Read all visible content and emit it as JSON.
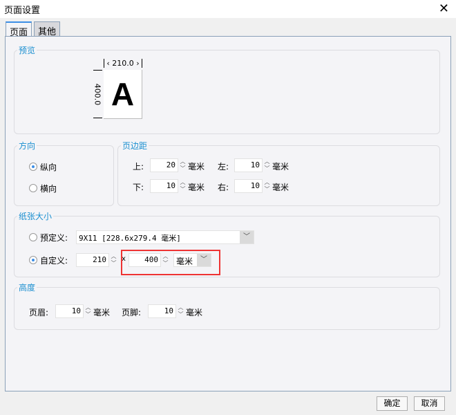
{
  "window": {
    "title": "页面设置",
    "close": "✕"
  },
  "tabs": [
    {
      "label": "页面"
    },
    {
      "label": "其他"
    }
  ],
  "preview": {
    "label": "预览",
    "width_label": "210.0",
    "height_label": "400.0",
    "letter": "A"
  },
  "orientation": {
    "label": "方向",
    "options": [
      {
        "label": "纵向",
        "selected": true
      },
      {
        "label": "横向",
        "selected": false
      }
    ]
  },
  "margins": {
    "label": "页边距",
    "unit": "毫米",
    "top": {
      "label": "上:",
      "value": "20"
    },
    "left": {
      "label": "左:",
      "value": "10"
    },
    "bottom": {
      "label": "下:",
      "value": "10"
    },
    "right": {
      "label": "右:",
      "value": "10"
    }
  },
  "paper": {
    "label": "纸张大小",
    "predefined_label": "预定义:",
    "predefined_value": "9X11 [228.6x279.4 毫米]",
    "custom_label": "自定义:",
    "width": "210",
    "x": "x",
    "height": "400",
    "unit": "毫米",
    "highlight_color": "#ee3333"
  },
  "height_section": {
    "label": "高度",
    "header_label": "页眉:",
    "header_value": "10",
    "footer_label": "页脚:",
    "footer_value": "10",
    "unit": "毫米"
  },
  "buttons": {
    "ok": "确定",
    "cancel": "取消"
  }
}
